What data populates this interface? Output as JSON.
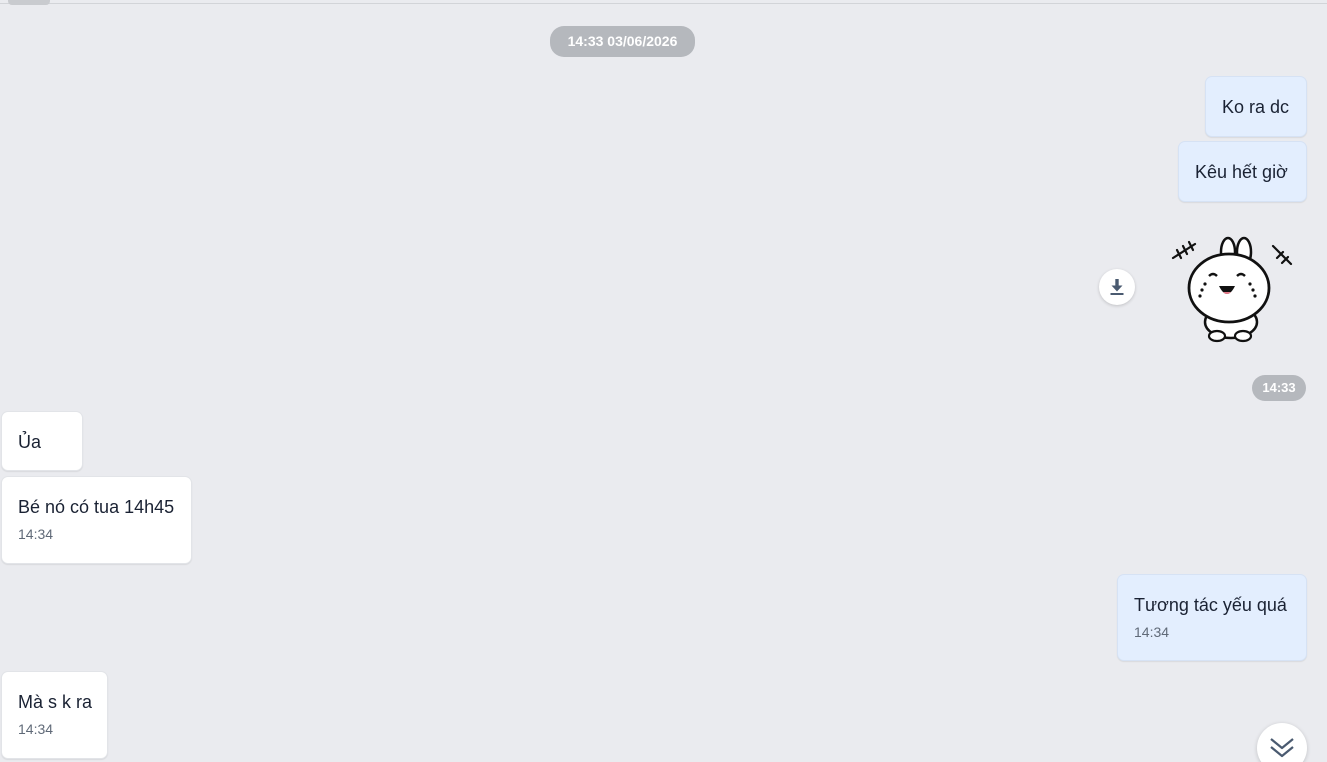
{
  "conversation": {
    "date_separator": "14:33 03/06/2026",
    "group_time_1": "14:33",
    "messages": [
      {
        "side": "me",
        "text": "Ko ra dc"
      },
      {
        "side": "me",
        "text": "Kêu hết giờ"
      },
      {
        "side": "me",
        "type": "sticker",
        "sticker": "crying-bunny-sticker"
      },
      {
        "side": "them",
        "text": "Ủa"
      },
      {
        "side": "them",
        "text": "Bé nó có tua 14h45",
        "time": "14:34"
      },
      {
        "side": "me",
        "text": "Tương tác yếu quá",
        "time": "14:34"
      },
      {
        "side": "them",
        "text": "Mà s k ra",
        "time": "14:34"
      }
    ]
  },
  "icons": {
    "download": "download-icon",
    "scroll_bottom": "double-chevron-down-icon"
  },
  "colors": {
    "background": "#eaebef",
    "my_bubble": "#e3eefe",
    "their_bubble": "#ffffff",
    "timestamp_pill": "#b5b8bd"
  }
}
